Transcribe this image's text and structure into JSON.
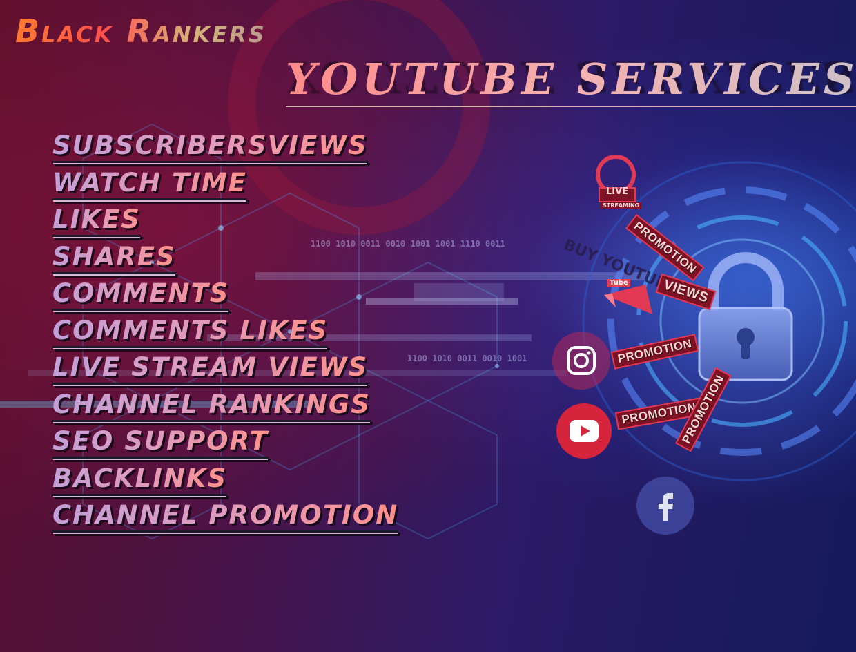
{
  "brand": {
    "name": "Black Rankers",
    "color_from": "#ff7a2e",
    "color_to": "#b99a8e"
  },
  "title": {
    "text": "Youtube Services",
    "color": "#f5b0b0"
  },
  "services": [
    "SUBSCRIBERSVIEWS",
    "WATCH TIME",
    "LIKES",
    "SHARES",
    "COMMENTS",
    "COMMENTS LIKES",
    "LIVE STREAM VIEWS",
    "CHANNEL RANKINGS",
    "SEO SUPPORT",
    "BACKLINKS",
    "CHANNEL PROMOTION"
  ],
  "artwork": {
    "binary_top": "1100 1010 0011 0010 1001 1001 1110 0011",
    "binary_bottom": "1100 1010 0011 0010 1001",
    "live_badge": {
      "title": "LIVE",
      "subtitle": "STREAMING"
    },
    "buy_text": "BUY YOUTUBE",
    "views_sticker": "VIEWS",
    "tube_tag": "Tube",
    "promotion_stickers": [
      "PROMOTION",
      "PROMOTION",
      "PROMOTION",
      "PROMOTION"
    ],
    "icons": [
      "instagram-icon",
      "youtube-icon",
      "facebook-icon",
      "padlock-icon",
      "megaphone-icon"
    ],
    "colors": {
      "accent_red": "#e23a55",
      "lock_blue": "#6b86d8",
      "glow_blue": "#3c78ff"
    }
  }
}
